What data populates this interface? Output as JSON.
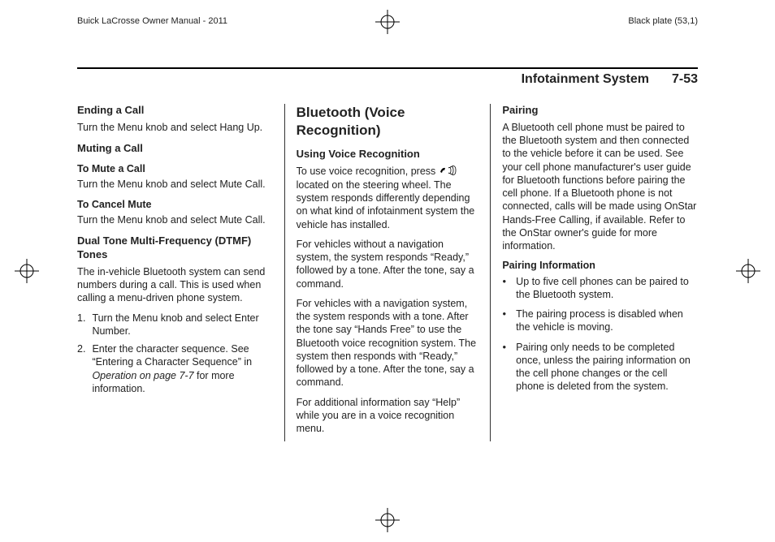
{
  "top": {
    "left": "Buick LaCrosse Owner Manual - 2011",
    "right": "Black plate (53,1)"
  },
  "header": {
    "section": "Infotainment System",
    "page": "7-53"
  },
  "col1": {
    "h1": "Ending a Call",
    "p1": "Turn the Menu knob and select Hang Up.",
    "h2": "Muting a Call",
    "h2a": "To Mute a Call",
    "p2": "Turn the Menu knob and select Mute Call.",
    "h2b": "To Cancel Mute",
    "p3": "Turn the Menu knob and select Mute Call.",
    "h3": "Dual Tone Multi-Frequency (DTMF) Tones",
    "p4": "The in-vehicle Bluetooth system can send numbers during a call. This is used when calling a menu-driven phone system.",
    "li1_num": "1.",
    "li1": "Turn the Menu knob and select Enter Number.",
    "li2_num": "2.",
    "li2a": "Enter the character sequence. See “Entering a Character Sequence” in ",
    "li2b": "Operation on page 7-7",
    "li2c": " for more information."
  },
  "col2": {
    "h1": "Bluetooth (Voice Recognition)",
    "h2": "Using Voice Recognition",
    "p1a": "To use voice recognition, press ",
    "p1b": " located on the steering wheel. The system responds differently depending on what kind of infotainment system the vehicle has installed.",
    "p2": "For vehicles without a navigation system, the system responds “Ready,” followed by a tone. After the tone, say a command.",
    "p3": "For vehicles with a navigation system, the system responds with a tone. After the tone say “Hands Free” to use the Bluetooth voice recognition system. The system then responds with “Ready,” followed by a tone. After the tone, say a command.",
    "p4": "For additional information say “Help” while you are in a voice recognition menu."
  },
  "col3": {
    "h1": "Pairing",
    "p1": "A Bluetooth cell phone must be paired to the Bluetooth system and then connected to the vehicle before it can be used. See your cell phone manufacturer's user guide for Bluetooth functions before pairing the cell phone. If a Bluetooth phone is not connected, calls will be made using OnStar Hands-Free Calling, if available. Refer to the OnStar owner's guide for more information.",
    "h2": "Pairing Information",
    "li1": "Up to five cell phones can be paired to the Bluetooth system.",
    "li2": "The pairing process is disabled when the vehicle is moving.",
    "li3": "Pairing only needs to be completed once, unless the pairing information on the cell phone changes or the cell phone is deleted from the system."
  }
}
